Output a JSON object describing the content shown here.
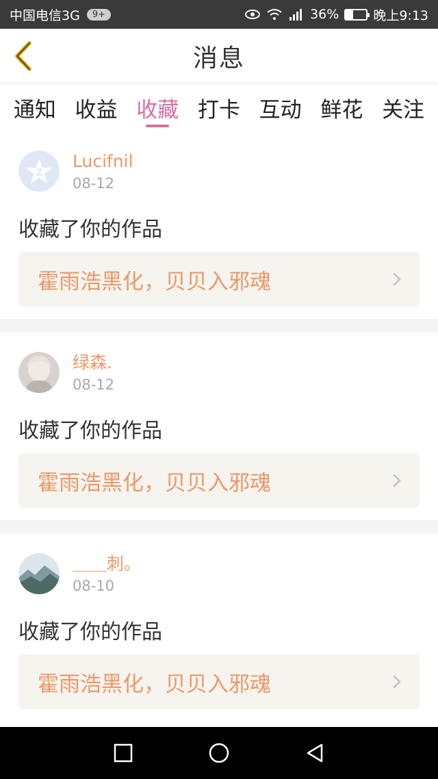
{
  "status_bar": {
    "carrier": "中国电信3G",
    "badge": "9+",
    "battery": "36%",
    "battery_level": 0.36,
    "time": "晚上9:13",
    "icons": [
      "eye-icon",
      "wifi-icon",
      "signal-icon",
      "battery-icon"
    ]
  },
  "header": {
    "title": "消息",
    "back_icon": "chevron-left-icon"
  },
  "tabs": [
    {
      "label": "通知",
      "active": false
    },
    {
      "label": "收益",
      "active": false
    },
    {
      "label": "收藏",
      "active": true
    },
    {
      "label": "打卡",
      "active": false
    },
    {
      "label": "互动",
      "active": false
    },
    {
      "label": "鲜花",
      "active": false
    },
    {
      "label": "关注",
      "active": false
    }
  ],
  "messages": [
    {
      "user": "Lucifnil",
      "date": "08-12",
      "action": "收藏了你的作品",
      "work_title": "霍雨浩黑化，贝贝入邪魂"
    },
    {
      "user": "绿森.",
      "date": "08-12",
      "action": "收藏了你的作品",
      "work_title": "霍雨浩黑化，贝贝入邪魂"
    },
    {
      "user": "＿＿刺。",
      "date": "08-10",
      "action": "收藏了你的作品",
      "work_title": "霍雨浩黑化，贝贝入邪魂"
    }
  ],
  "colors": {
    "accent": "#d86fa3",
    "username": "#ec9868",
    "work_bg": "#f6f4ef"
  }
}
